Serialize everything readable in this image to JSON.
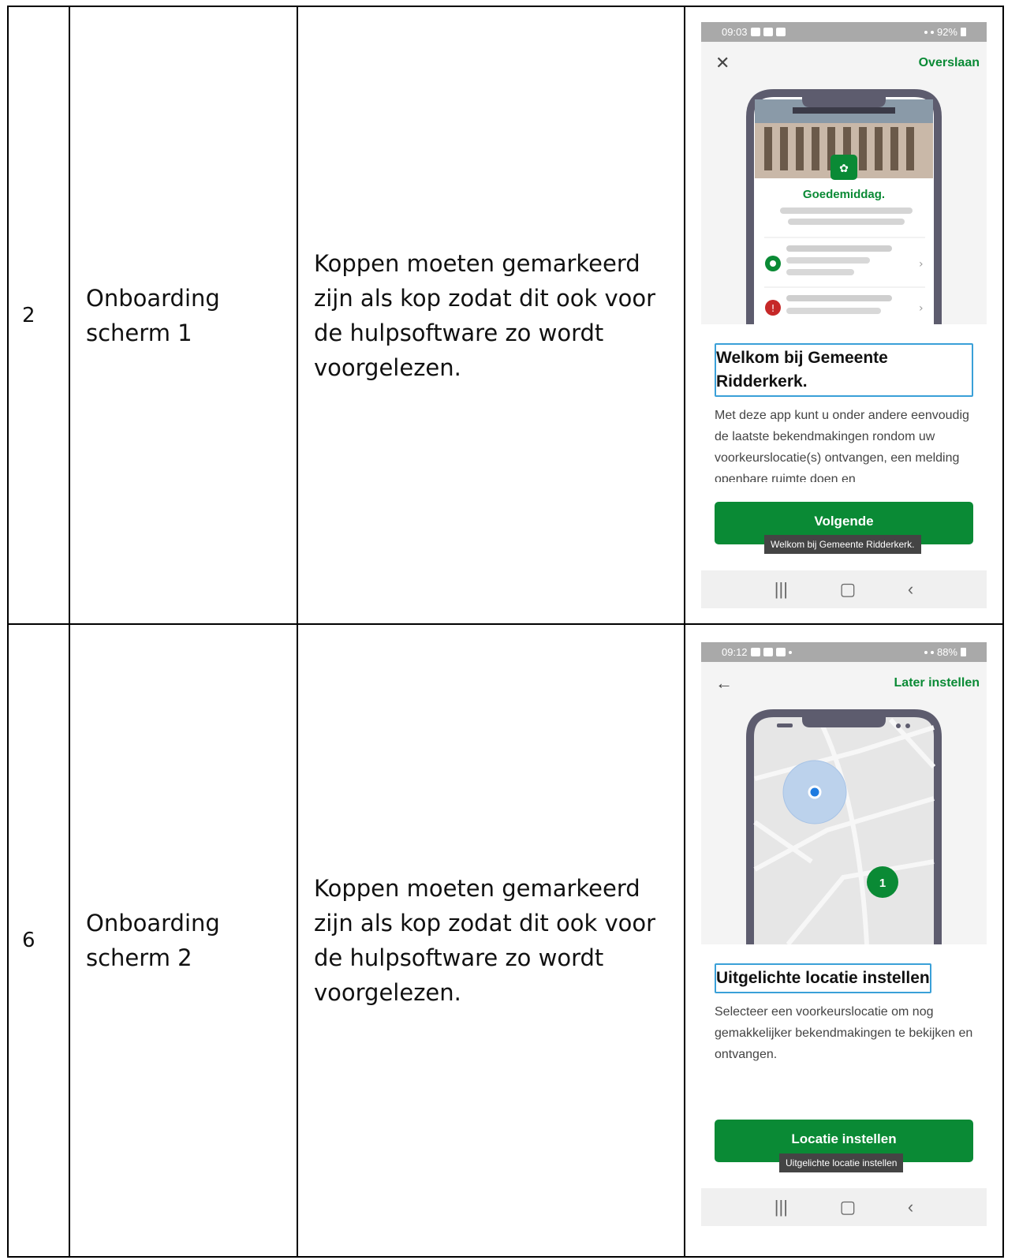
{
  "rows": [
    {
      "number": "2",
      "name": "Onboarding scherm 1",
      "description": "Koppen moeten gemarkeerd zijn als kop zodat dit ook voor de hulpsoftware zo wordt voorgelezen.",
      "screen": {
        "status_time": "09:03",
        "status_battery": "92%",
        "action_label": "Overslaan",
        "close_icon": "close-icon",
        "greeting": "Goedemiddag.",
        "heading": "Welkom bij Gemeente Ridderkerk.",
        "body": "Met deze app kunt u onder andere eenvoudig de laatste bekendmakingen rondom uw voorkeurslocatie(s) ontvangen, een melding openbare ruimte doen en",
        "button_label": "Volgende",
        "tooltip": "Welkom bij Gemeente Ridderkerk."
      }
    },
    {
      "number": "6",
      "name": "Onboarding scherm 2",
      "description": "Koppen moeten gemarkeerd zijn als kop zodat dit ook voor de hulpsoftware zo wordt voorgelezen.",
      "screen": {
        "status_time": "09:12",
        "status_battery": "88%",
        "action_label": "Later instellen",
        "back_icon": "arrow-left-icon",
        "map_badge": "1",
        "heading": "Uitgelichte locatie instellen",
        "body": "Selecteer een voorkeurslocatie om nog gemakkelijker bekendmakingen te bekijken en ontvangen.",
        "button_label": "Locatie instellen",
        "tooltip": "Uitgelichte locatie instellen"
      }
    }
  ],
  "nav_glyphs": {
    "recent": "|||",
    "home": "▢",
    "back": "‹"
  },
  "colors": {
    "brand_green": "#0a8a35",
    "focus_outline": "#3aa0d8",
    "alert_red": "#c62828"
  }
}
